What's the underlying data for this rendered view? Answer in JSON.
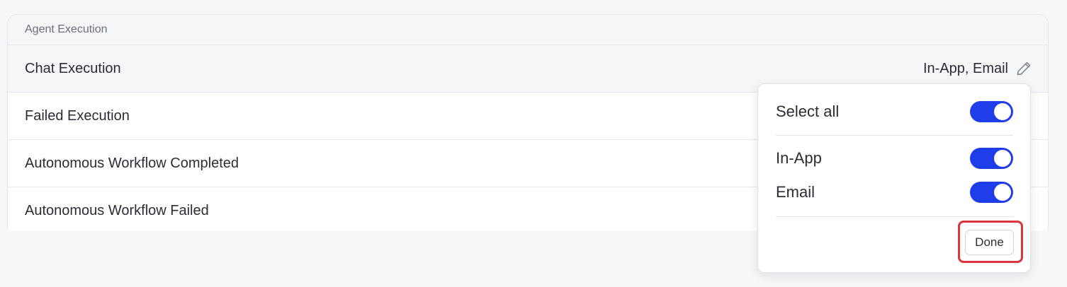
{
  "section": {
    "title": "Agent Execution",
    "rows": [
      {
        "label": "Chat Execution",
        "value": "In-App, Email"
      },
      {
        "label": "Failed Execution"
      },
      {
        "label": "Autonomous Workflow Completed"
      },
      {
        "label": "Autonomous Workflow Failed"
      }
    ]
  },
  "popover": {
    "select_all": {
      "label": "Select all",
      "enabled": true
    },
    "options": [
      {
        "label": "In-App",
        "enabled": true
      },
      {
        "label": "Email",
        "enabled": true
      }
    ],
    "done_label": "Done"
  },
  "colors": {
    "accent": "#1f3de8",
    "highlight": "#d9363e"
  },
  "icons": {
    "edit": "pencil-icon"
  }
}
